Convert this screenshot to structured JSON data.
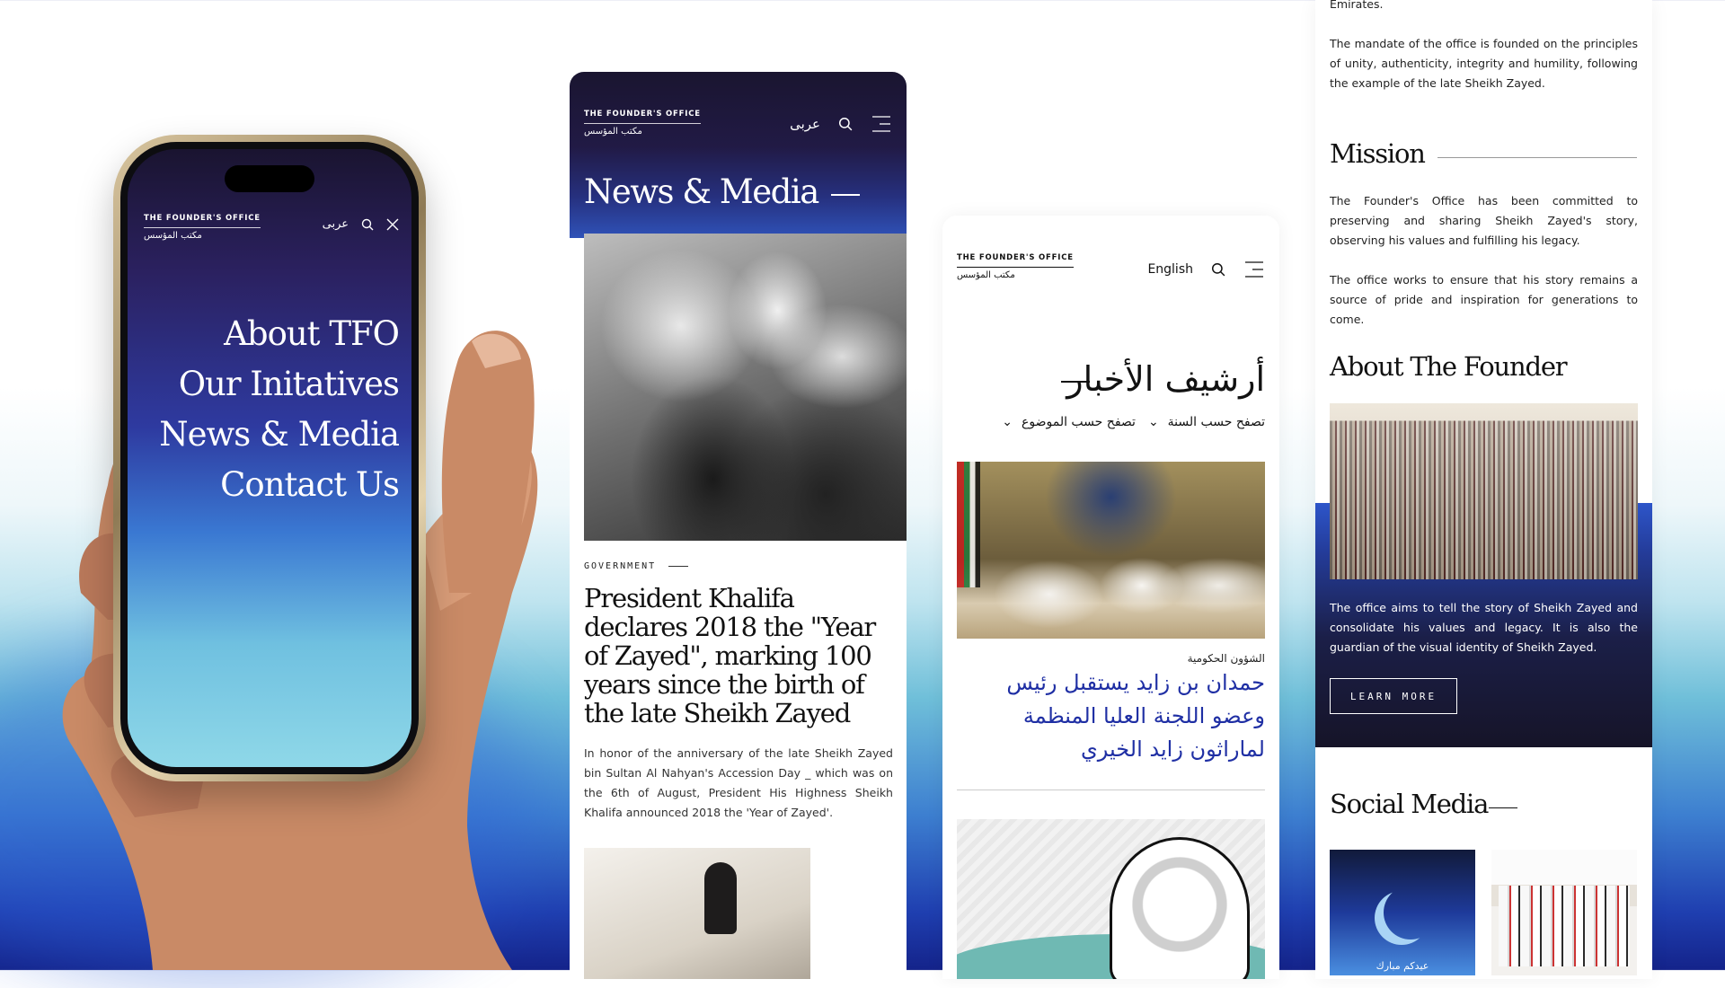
{
  "phone": {
    "logo_en": "THE FOUNDER'S OFFICE",
    "logo_ar": "مكتب المؤسس",
    "lang": "عربى",
    "menu": [
      "About TFO",
      "Our Initatives",
      "News & Media",
      "Contact Us"
    ]
  },
  "news": {
    "logo_en": "THE FOUNDER'S OFFICE",
    "logo_ar": "مكتب المؤسس",
    "lang": "عربى",
    "title": "News & Media",
    "category": "GOVERNMENT",
    "headline": "President Khalifa declares 2018 the \"Year of Zayed\", marking 100 years since the birth of the late Sheikh Zayed",
    "body": "In honor of the anniversary of the late Sheikh Zayed bin Sultan Al Nahyan's Accession Day _ which was on the 6th of August, President His Highness Sheikh Khalifa announced 2018 the 'Year of Zayed'."
  },
  "archive": {
    "logo_en": "THE FOUNDER'S OFFICE",
    "logo_ar": "مكتب المؤسس",
    "lang": "English",
    "title": "أرشيف الأخبار",
    "filter_topic": "تصفح حسب الموضوع",
    "filter_year": "تصفح حسب السنة",
    "category": "الشؤون الحكومية",
    "headline": "حمدان بن زايد يستقبل رئيس وعضو اللجنة العليا المنظمة لماراثون زايد الخيري"
  },
  "about": {
    "p0": "Emirates.",
    "p1": "The mandate of the office is founded on the principles of unity, authenticity, integrity and humility, following the example of the late Sheikh Zayed.",
    "mission_title": "Mission",
    "mission_p1": "The Founder's Office has been committed to preserving and sharing Sheikh Zayed's story, observing his values and fulfilling his legacy.",
    "mission_p2": "The office works to ensure that his story remains a source of pride and inspiration for generations to come.",
    "founder_title": "About The Founder",
    "founder_text": "The office aims to tell the story of Sheikh Zayed and consolidate his values and legacy. It is also the guardian of the visual identity of Sheikh Zayed.",
    "learn_more": "LEARN MORE",
    "social_title": "Social Media",
    "social1_caption": "عيدكم مبارك"
  },
  "colors": {
    "navy": "#1a1530",
    "royal_blue": "#1f2fa4",
    "sky": "#6fc0e0"
  }
}
